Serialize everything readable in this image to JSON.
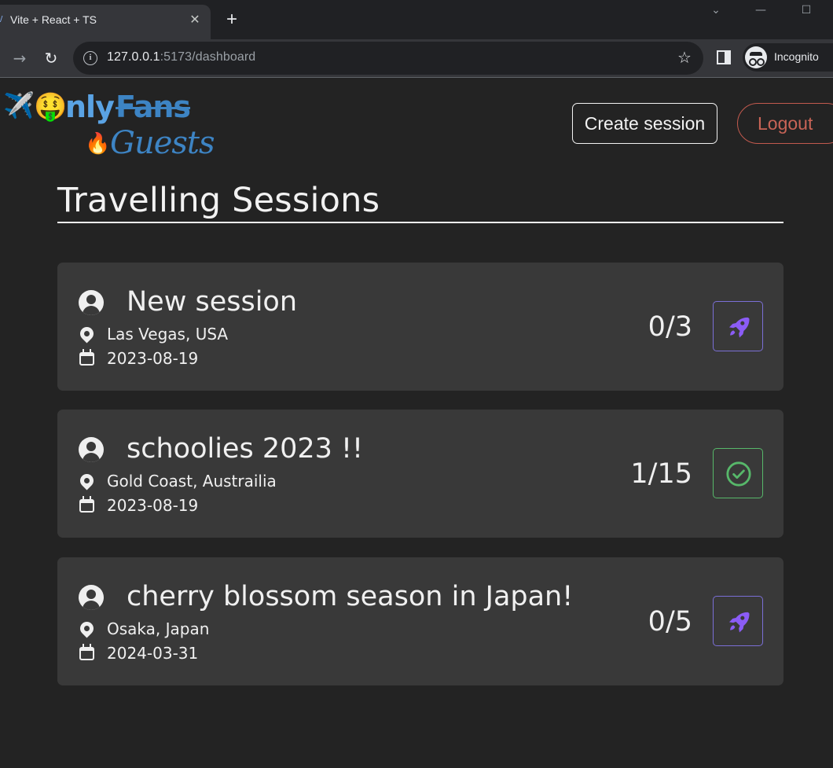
{
  "browser": {
    "tab_title": "Vite + React + TS",
    "tab_close": "✕",
    "new_tab": "+",
    "url_host": "127.0.0.1",
    "url_rest": ":5173/dashboard",
    "profile_label": "Incognito"
  },
  "header": {
    "logo": {
      "plane_emoji": "✈️",
      "face_emoji": "🤑",
      "word_nly": "nly",
      "word_fans": "Fans",
      "fire_emoji": "🔥",
      "word_guests": "Guests"
    },
    "create_session_label": "Create session",
    "logout_label": "Logout"
  },
  "page_title": "Travelling Sessions",
  "sessions": [
    {
      "title": "New session",
      "location": "Las Vegas, USA",
      "date": "2023-08-19",
      "count": "0/3",
      "action_icon": "rocket-icon"
    },
    {
      "title": "schoolies 2023 !!",
      "location": "Gold Coast, Austrailia",
      "date": "2023-08-19",
      "count": "1/15",
      "action_icon": "check-circle-icon"
    },
    {
      "title": "cherry blossom season in Japan!",
      "location": "Osaka, Japan",
      "date": "2024-03-31",
      "count": "0/5",
      "action_icon": "rocket-icon"
    }
  ],
  "colors": {
    "background": "#232323",
    "card": "#393939",
    "accent_blue": "#3d84c4",
    "logout_red": "#c96457",
    "rocket_purple": "#8b5cf6",
    "check_green": "#57b86a"
  }
}
